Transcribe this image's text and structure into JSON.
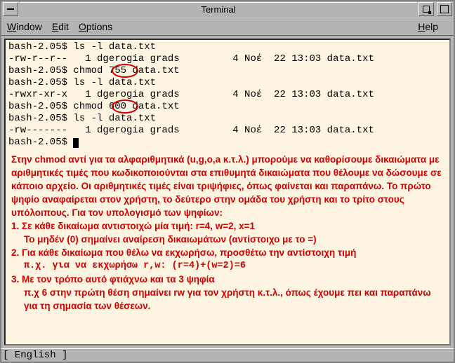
{
  "window": {
    "title": "Terminal"
  },
  "menubar": {
    "items": [
      {
        "label": "Window",
        "accel": "W"
      },
      {
        "label": "Edit",
        "accel": "E"
      },
      {
        "label": "Options",
        "accel": "O"
      }
    ],
    "help": {
      "label": "Help",
      "accel": "H"
    }
  },
  "terminal": {
    "lines": [
      "bash-2.05$ ls -l data.txt",
      "-rw-r--r--   1 dgerogia grads         4 Νοέ  22 13:03 data.txt",
      "bash-2.05$ chmod 755 data.txt",
      "bash-2.05$ ls -l data.txt",
      "-rwxr-xr-x   1 dgerogia grads         4 Νοέ  22 13:03 data.txt",
      "bash-2.05$ chmod 600 data.txt",
      "bash-2.05$ ls -l data.txt",
      "-rw-------   1 dgerogia grads         4 Νοέ  22 13:03 data.txt",
      "bash-2.05$ "
    ],
    "highlights": [
      {
        "text": "755",
        "line": 2
      },
      {
        "text": "600",
        "line": 5
      }
    ]
  },
  "annotation": {
    "para": "Στην chmod αντί για τα αλφαριθμητικά (u,g,o,a κ.τ.λ.) μπορούμε να καθορίσουμε δικαιώματα με αριθμητικές τιμές που κωδικοποιούνται στα επιθυμητά δικαιώματα που θέλουμε να δώσουμε σε κάποιο αρχείο. Οι αριθμητικές τιμές είναι τριψήφιες, όπως φαίνεται και παραπάνω. Το πρώτο ψηφίο αναφαίρεται στον χρήστη, το δεύτερο στην ομάδα του χρήστη και το τρίτο στους υπόλοιπους. Για τον υπολογισμό των ψηφίων:",
    "item1": "1. Σε κάθε δικαίωμα αντιστοιχώ μία τιμή: r=4, w=2, x=1",
    "item1b": "Το μηδέν (0) σημαίνει αναίρεση δικαιωμάτων (αντίστοιχο με το =)",
    "item2": "2. Για κάθε δικαίωμα που θέλω να εκχωρήσω, προσθέτω την αντίστοιχη τιμή",
    "item2b": "π.χ. για να εκχωρήσω r,w:  (r=4)+(w=2)=6",
    "item3": "3. Με τον τρόπο αυτό φτιάχνω και τα 3 ψηφία",
    "item3b": "π.χ 6 στην πρώτη θέση σημαίνει rw για τον χρήστη κ.τ.λ., όπως έχουμε πει και παραπάνω για τη σημασία των θέσεων."
  },
  "statusbar": {
    "text": "[ English ]"
  }
}
